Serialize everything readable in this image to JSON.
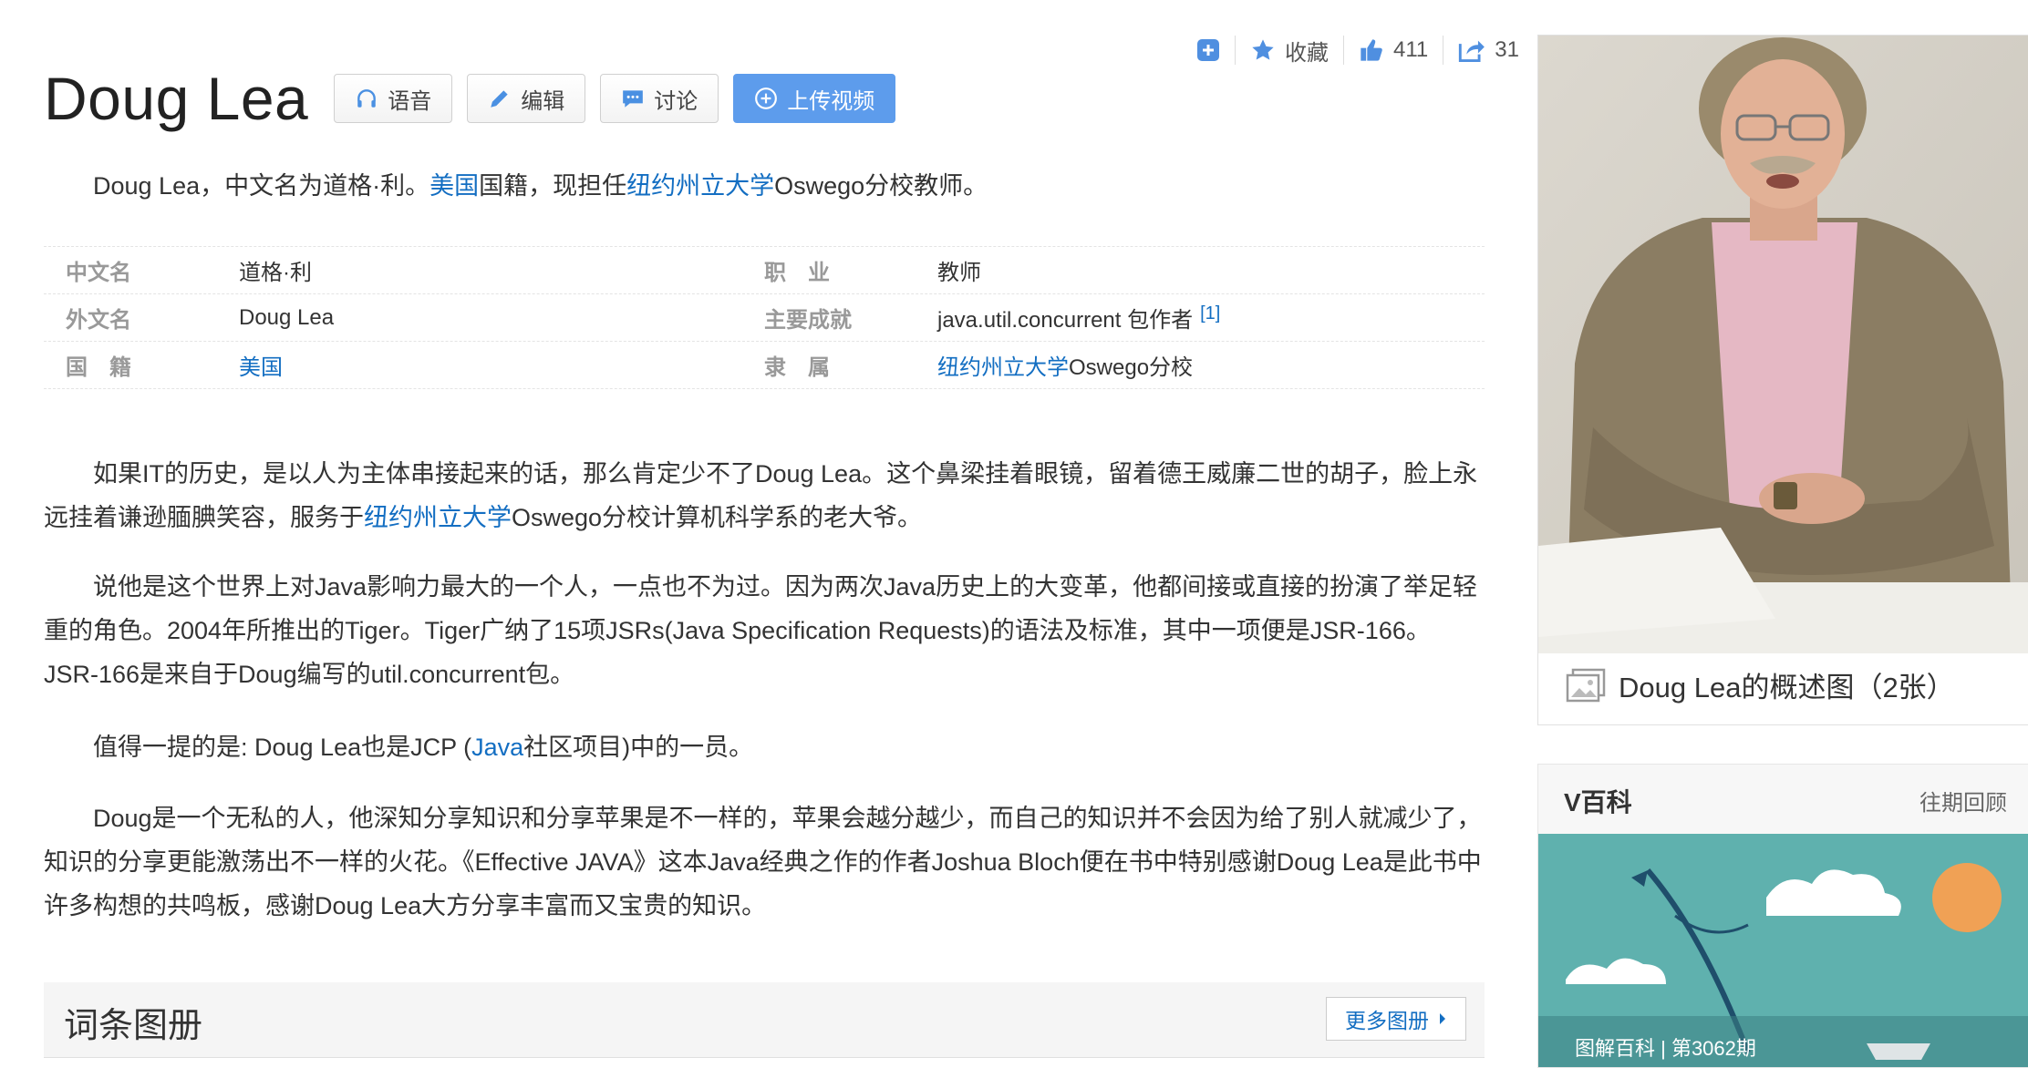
{
  "toolbar": {
    "favorite_label": "收藏",
    "like_count": "411",
    "share_count": "31"
  },
  "title": "Doug Lea",
  "buttons": {
    "voice": "语音",
    "edit": "编辑",
    "discuss": "讨论",
    "upload_video": "上传视频"
  },
  "summary": {
    "part1": "Doug Lea，中文名为道格·利。",
    "link1": "美国",
    "part2": "国籍，现担任",
    "link2": "纽约州立大学",
    "part3": "Oswego分校教师。"
  },
  "info": {
    "rows": [
      {
        "label1": "中文名",
        "value1": "道格·利",
        "label2": "职　业",
        "value2": "教师"
      },
      {
        "label1": "外文名",
        "value1": "Doug Lea",
        "label2": "主要成就",
        "value2": "java.util.concurrent 包作者",
        "ref": "[1]"
      },
      {
        "label1": "国　籍",
        "value1": "美国",
        "label2": "隶　属",
        "value2_link": "纽约州立大学",
        "value2_rest": "Oswego分校"
      }
    ]
  },
  "paragraphs": {
    "p1_a": "如果IT的历史，是以人为主体串接起来的话，那么肯定少不了Doug Lea。这个鼻梁挂着眼镜，留着德王威廉二世的胡子，脸上永远挂着谦逊腼腆笑容，服务于",
    "p1_link": "纽约州立大学",
    "p1_b": "Oswego分校计算机科学系的老大爷。",
    "p2": "说他是这个世界上对Java影响力最大的一个人，一点也不为过。因为两次Java历史上的大变革，他都间接或直接的扮演了举足轻重的角色。2004年所推出的Tiger。Tiger广纳了15项JSRs(Java Specification Requests)的语法及标准，其中一项便是JSR-166。JSR-166是来自于Doug编写的util.concurrent包。",
    "p3_a": "值得一提的是: Doug Lea也是JCP (",
    "p3_link": "Java",
    "p3_b": "社区项目)中的一员。",
    "p4": "Doug是一个无私的人，他深知分享知识和分享苹果是不一样的，苹果会越分越少，而自己的知识并不会因为给了别人就减少了，知识的分享更能激荡出不一样的火花。《Effective JAVA》这本Java经典之作的作者Joshua Bloch便在书中特别感谢Doug Lea是此书中许多构想的共鸣板，感谢Doug Lea大方分享丰富而又宝贵的知识。"
  },
  "album": {
    "title": "词条图册",
    "more": "更多图册"
  },
  "photo": {
    "caption": "Doug Lea的概述图（2张）"
  },
  "vbaike": {
    "title": "V百科",
    "more": "往期回顾",
    "tag": "图解百科 | 第3062期"
  }
}
